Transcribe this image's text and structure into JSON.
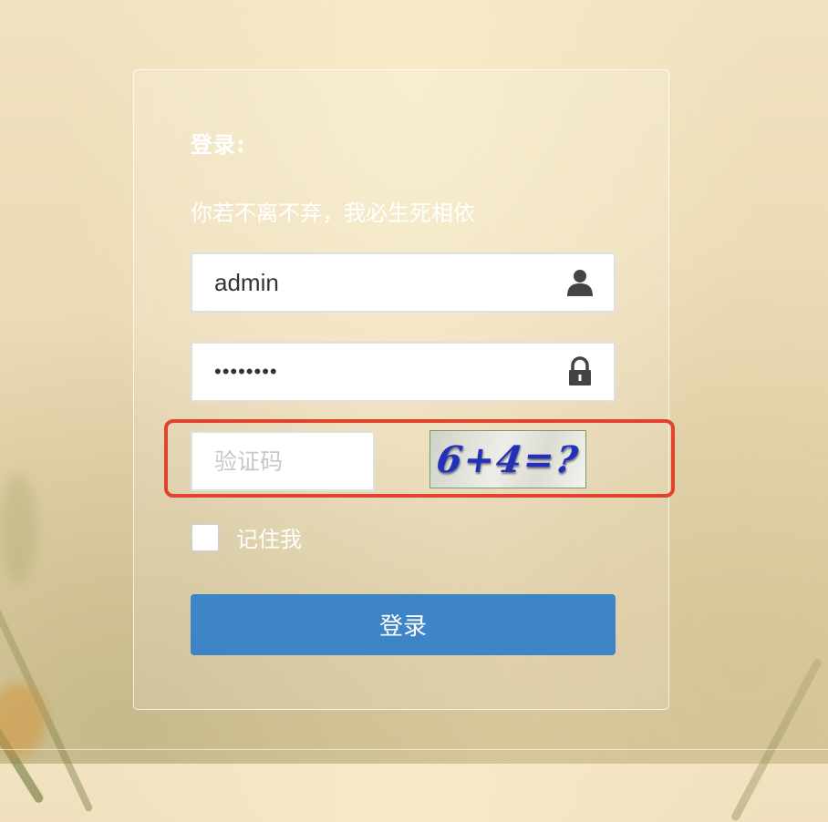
{
  "login": {
    "title": "登录:",
    "slogan": "你若不离不弃，我必生死相依",
    "username": {
      "value": "admin",
      "icon": "user-icon"
    },
    "password": {
      "value": "••••••••",
      "icon": "lock-icon"
    },
    "captcha": {
      "placeholder": "验证码",
      "value": "",
      "image_text": "6+4=?"
    },
    "remember_label": "记住我",
    "remember_checked": false,
    "submit_label": "登录"
  },
  "colors": {
    "button": "#3d85c6",
    "highlight": "#e2432d",
    "captcha_text": "#2331b8"
  }
}
